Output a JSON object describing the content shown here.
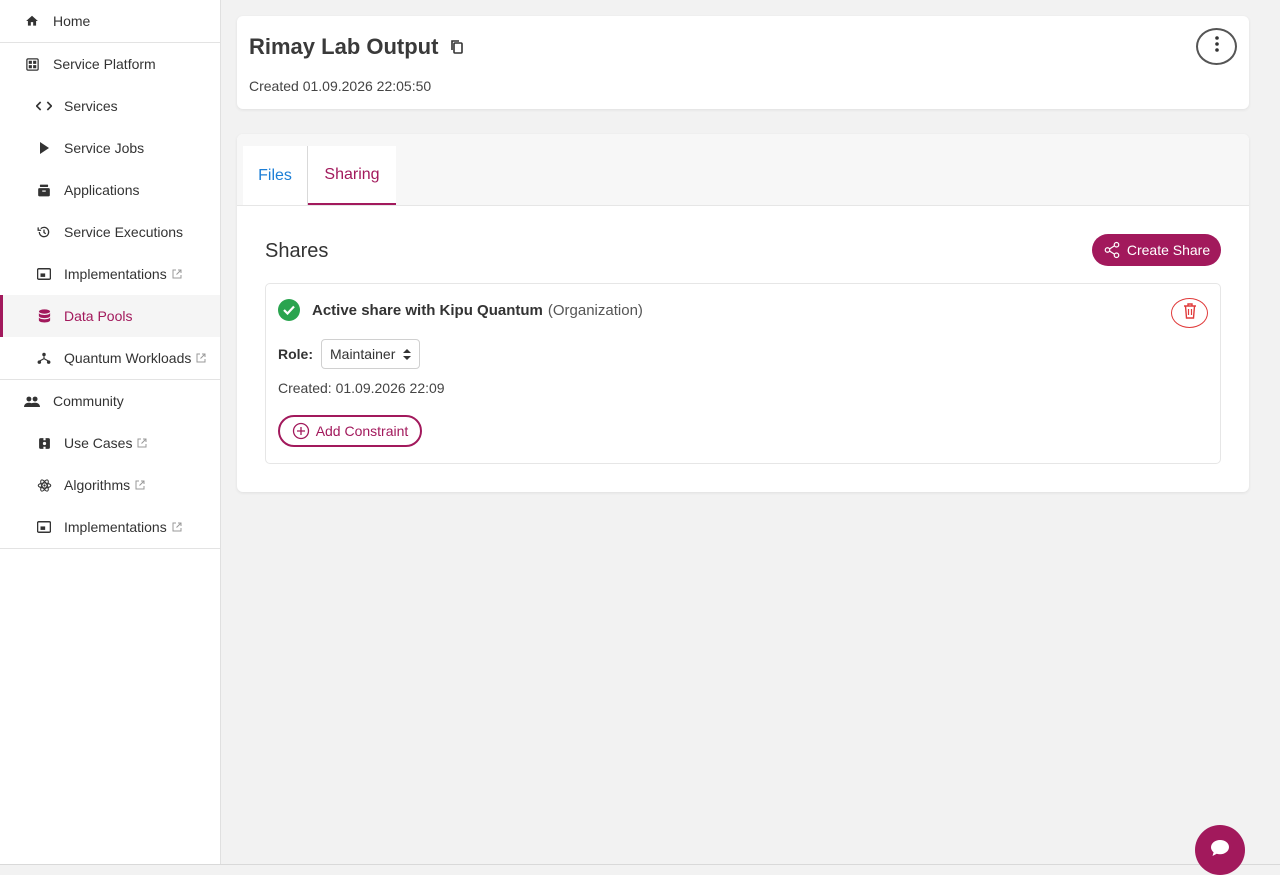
{
  "sidebar": {
    "home": "Home",
    "service_platform": "Service Platform",
    "services": "Services",
    "service_jobs": "Service Jobs",
    "applications": "Applications",
    "service_executions": "Service Executions",
    "implementations": "Implementations",
    "data_pools": "Data Pools",
    "quantum_workloads": "Quantum Workloads",
    "community": "Community",
    "use_cases": "Use Cases",
    "algorithms": "Algorithms",
    "community_implementations": "Implementations"
  },
  "header": {
    "title": "Rimay Lab Output",
    "created": "Created 01.09.2026 22:05:50"
  },
  "tabs": {
    "files": "Files",
    "sharing": "Sharing"
  },
  "shares": {
    "title": "Shares",
    "create_label": "Create Share",
    "item": {
      "name": "Active share with Kipu Quantum",
      "type": "(Organization)",
      "role_label": "Role:",
      "role_value": "Maintainer",
      "created": "Created: 01.09.2026 22:09",
      "add_constraint": "Add Constraint"
    }
  },
  "colors": {
    "accent": "#a2195c",
    "link": "#1c7ed6",
    "success": "#2aa44f",
    "danger": "#e03b3b"
  }
}
